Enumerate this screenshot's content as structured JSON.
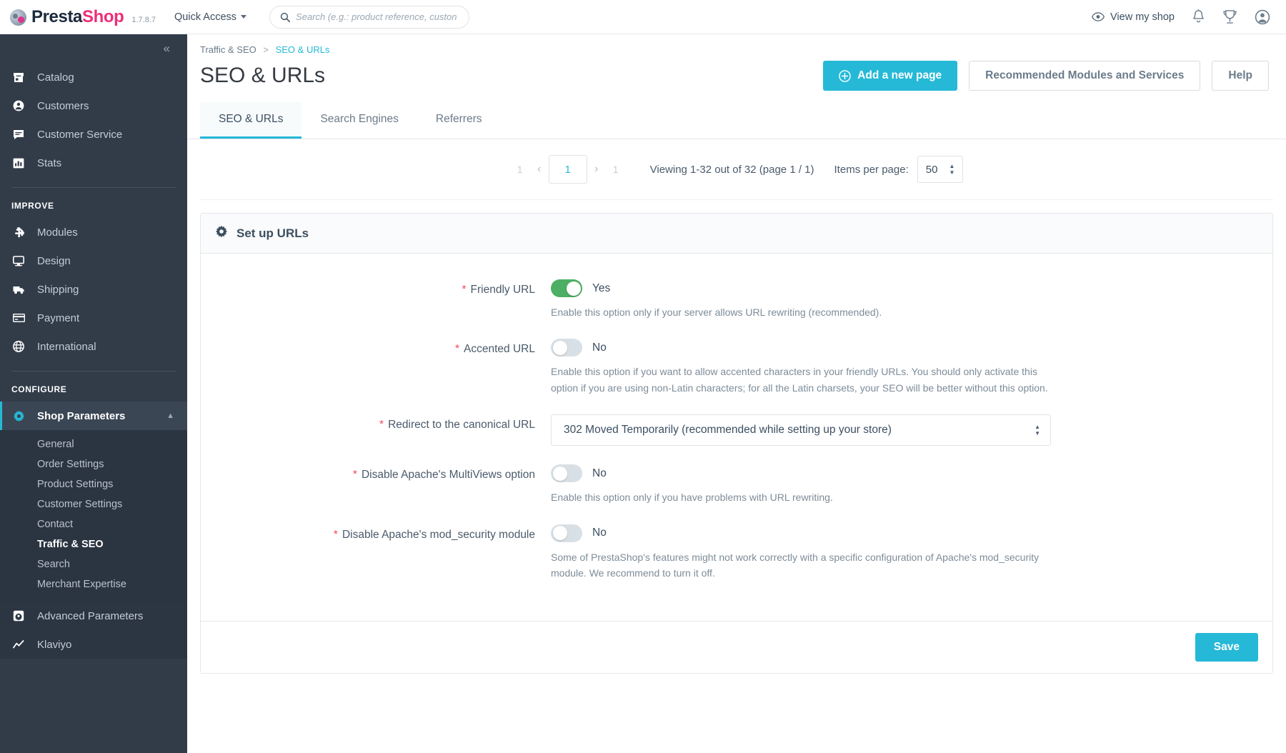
{
  "topbar": {
    "brand_part1": "Presta",
    "brand_part2": "Shop",
    "version": "1.7.8.7",
    "quick_access_label": "Quick Access",
    "search_placeholder": "Search (e.g.: product reference, custon",
    "search_value": "",
    "view_shop_label": "View my shop",
    "icons": [
      "eye-icon",
      "bell-icon",
      "trophy-icon",
      "account-icon"
    ]
  },
  "sidebar": {
    "collapse_label": "«",
    "groups": [
      {
        "heading": null,
        "items": [
          {
            "label": "Catalog",
            "icon": "store-icon",
            "active": false
          },
          {
            "label": "Customers",
            "icon": "person-icon",
            "active": false
          },
          {
            "label": "Customer Service",
            "icon": "chat-icon",
            "active": false
          },
          {
            "label": "Stats",
            "icon": "chart-bar-icon",
            "active": false
          }
        ]
      },
      {
        "heading": "IMPROVE",
        "items": [
          {
            "label": "Modules",
            "icon": "puzzle-icon",
            "active": false
          },
          {
            "label": "Design",
            "icon": "monitor-icon",
            "active": false
          },
          {
            "label": "Shipping",
            "icon": "truck-icon",
            "active": false
          },
          {
            "label": "Payment",
            "icon": "credit-card-icon",
            "active": false
          },
          {
            "label": "International",
            "icon": "globe-icon",
            "active": false
          }
        ]
      },
      {
        "heading": "CONFIGURE",
        "items": [
          {
            "label": "Shop Parameters",
            "icon": "gear-icon",
            "active": true
          }
        ]
      }
    ],
    "submenu": [
      {
        "label": "General",
        "active": false
      },
      {
        "label": "Order Settings",
        "active": false
      },
      {
        "label": "Product Settings",
        "active": false
      },
      {
        "label": "Customer Settings",
        "active": false
      },
      {
        "label": "Contact",
        "active": false
      },
      {
        "label": "Traffic & SEO",
        "active": true
      },
      {
        "label": "Search",
        "active": false
      },
      {
        "label": "Merchant Expertise",
        "active": false
      }
    ],
    "footer_items": [
      {
        "label": "Advanced Parameters",
        "icon": "sliders-icon"
      },
      {
        "label": "Klaviyo",
        "icon": "klaviyo-icon"
      }
    ]
  },
  "page": {
    "breadcrumb_parent": "Traffic & SEO",
    "breadcrumb_sep": ">",
    "breadcrumb_current": "SEO & URLs",
    "title": "SEO & URLs",
    "actions": {
      "add_page": "Add a new page",
      "add_page_icon": "plus-circle-icon",
      "recommended": "Recommended Modules and Services",
      "help": "Help"
    },
    "tabs": [
      {
        "label": "SEO & URLs",
        "active": true
      },
      {
        "label": "Search Engines",
        "active": false
      },
      {
        "label": "Referrers",
        "active": false
      }
    ]
  },
  "pagination": {
    "first_ghost": "1",
    "prev_arrow": "‹",
    "current_page": "1",
    "next_arrow": "›",
    "last_ghost": "1",
    "info": "Viewing 1-32 out of 32 (page 1 / 1)",
    "items_per_page_label": "Items per page:",
    "items_per_page_value": "50"
  },
  "panel": {
    "icon": "gear-icon",
    "title": "Set up URLs",
    "rows": [
      {
        "label": "Friendly URL",
        "required": true,
        "type": "toggle",
        "state": "on",
        "state_text": "Yes",
        "help": "Enable this option only if your server allows URL rewriting (recommended)."
      },
      {
        "label": "Accented URL",
        "required": true,
        "type": "toggle",
        "state": "off",
        "state_text": "No",
        "help": "Enable this option if you want to allow accented characters in your friendly URLs. You should only activate this option if you are using non-Latin characters; for all the Latin charsets, your SEO will be better without this option."
      },
      {
        "label": "Redirect to the canonical URL",
        "required": true,
        "type": "select",
        "value": "302 Moved Temporarily (recommended while setting up your store)",
        "help": ""
      },
      {
        "label": "Disable Apache's MultiViews option",
        "required": true,
        "type": "toggle",
        "state": "off",
        "state_text": "No",
        "help": "Enable this option only if you have problems with URL rewriting."
      },
      {
        "label": "Disable Apache's mod_security module",
        "required": true,
        "type": "toggle",
        "state": "off",
        "state_text": "No",
        "help": "Some of PrestaShop's features might not work correctly with a specific configuration of Apache's mod_security module. We recommend to turn it off."
      }
    ],
    "save_label": "Save"
  },
  "colors": {
    "accent": "#25b9d7",
    "brand_pink": "#ee2e7b",
    "sidebar_bg": "#323c49",
    "toggle_on": "#4caf63",
    "required": "#f5485e"
  }
}
